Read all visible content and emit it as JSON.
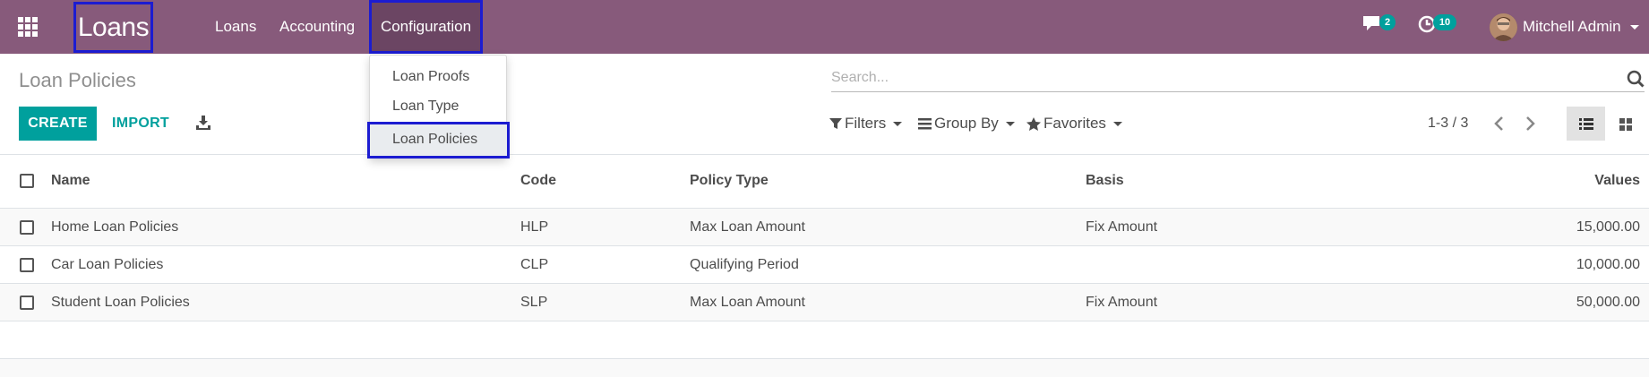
{
  "navbar": {
    "brand": "Loans",
    "menus": [
      {
        "label": "Loans"
      },
      {
        "label": "Accounting"
      },
      {
        "label": "Configuration"
      }
    ],
    "chat_badge": "2",
    "activity_badge": "10",
    "user_name": "Mitchell Admin",
    "background_color": "#875a7b"
  },
  "configuration_dropdown": {
    "items": [
      {
        "label": "Loan Proofs"
      },
      {
        "label": "Loan Type"
      },
      {
        "label": "Loan Policies"
      }
    ]
  },
  "control_panel": {
    "title": "Loan Policies",
    "search_placeholder": "Search...",
    "create_label": "CREATE",
    "import_label": "IMPORT",
    "filters_label": "Filters",
    "groupby_label": "Group By",
    "favorites_label": "Favorites",
    "pager": "1-3 / 3",
    "accent_color": "#00a09d"
  },
  "table": {
    "columns": [
      "Name",
      "Code",
      "Policy Type",
      "Basis",
      "Values"
    ],
    "rows": [
      {
        "name": "Home Loan Policies",
        "code": "HLP",
        "policy_type": "Max Loan Amount",
        "basis": "Fix Amount",
        "values": "15,000.00"
      },
      {
        "name": "Car Loan Policies",
        "code": "CLP",
        "policy_type": "Qualifying Period",
        "basis": "",
        "values": "10,000.00"
      },
      {
        "name": "Student Loan Policies",
        "code": "SLP",
        "policy_type": "Max Loan Amount",
        "basis": "Fix Amount",
        "values": "50,000.00"
      }
    ]
  }
}
